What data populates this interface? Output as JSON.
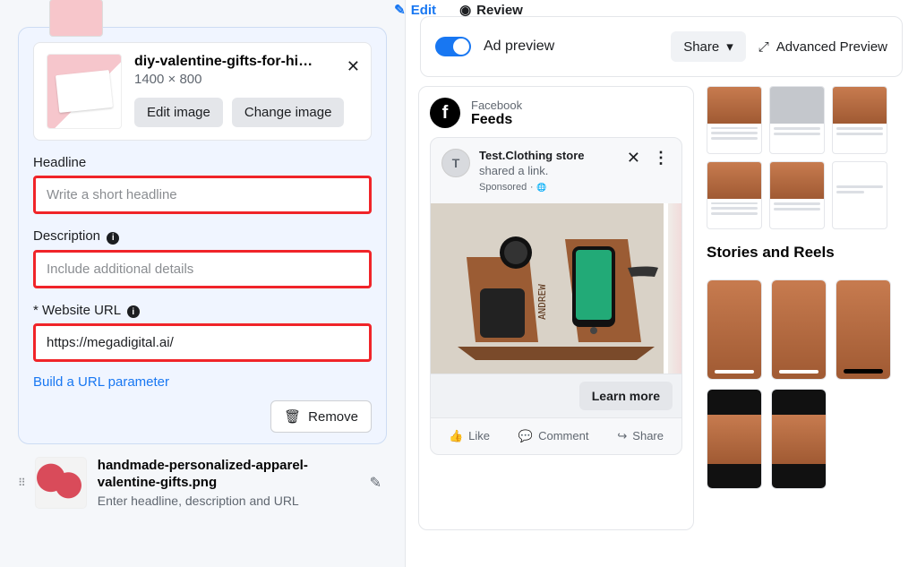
{
  "tabs": {
    "edit": "Edit",
    "review": "Review"
  },
  "media": {
    "filename": "diy-valentine-gifts-for-him-…",
    "dimensions": "1400 × 800",
    "edit_image": "Edit image",
    "change_image": "Change image"
  },
  "fields": {
    "headline_label": "Headline",
    "headline_placeholder": "Write a short headline",
    "description_label": "Description",
    "description_placeholder": "Include additional details",
    "url_label": "* Website URL",
    "url_value": "https://megadigital.ai/",
    "url_param_link": "Build a URL parameter",
    "remove": "Remove"
  },
  "bottom_media": {
    "filename": "handmade-personalized-apparel-valentine-gifts.png",
    "hint": "Enter headline, description and URL"
  },
  "preview": {
    "toggle_label": "Ad preview",
    "share": "Share",
    "advanced": "Advanced Preview",
    "placement_fb": "Facebook",
    "feeds": "Feeds",
    "page_name": "Test.Clothing store",
    "shared_link": " shared a link",
    "sponsored": "Sponsored",
    "cta": "Learn more",
    "like": "Like",
    "comment": "Comment",
    "share_action": "Share",
    "stories_title": "Stories and Reels"
  }
}
